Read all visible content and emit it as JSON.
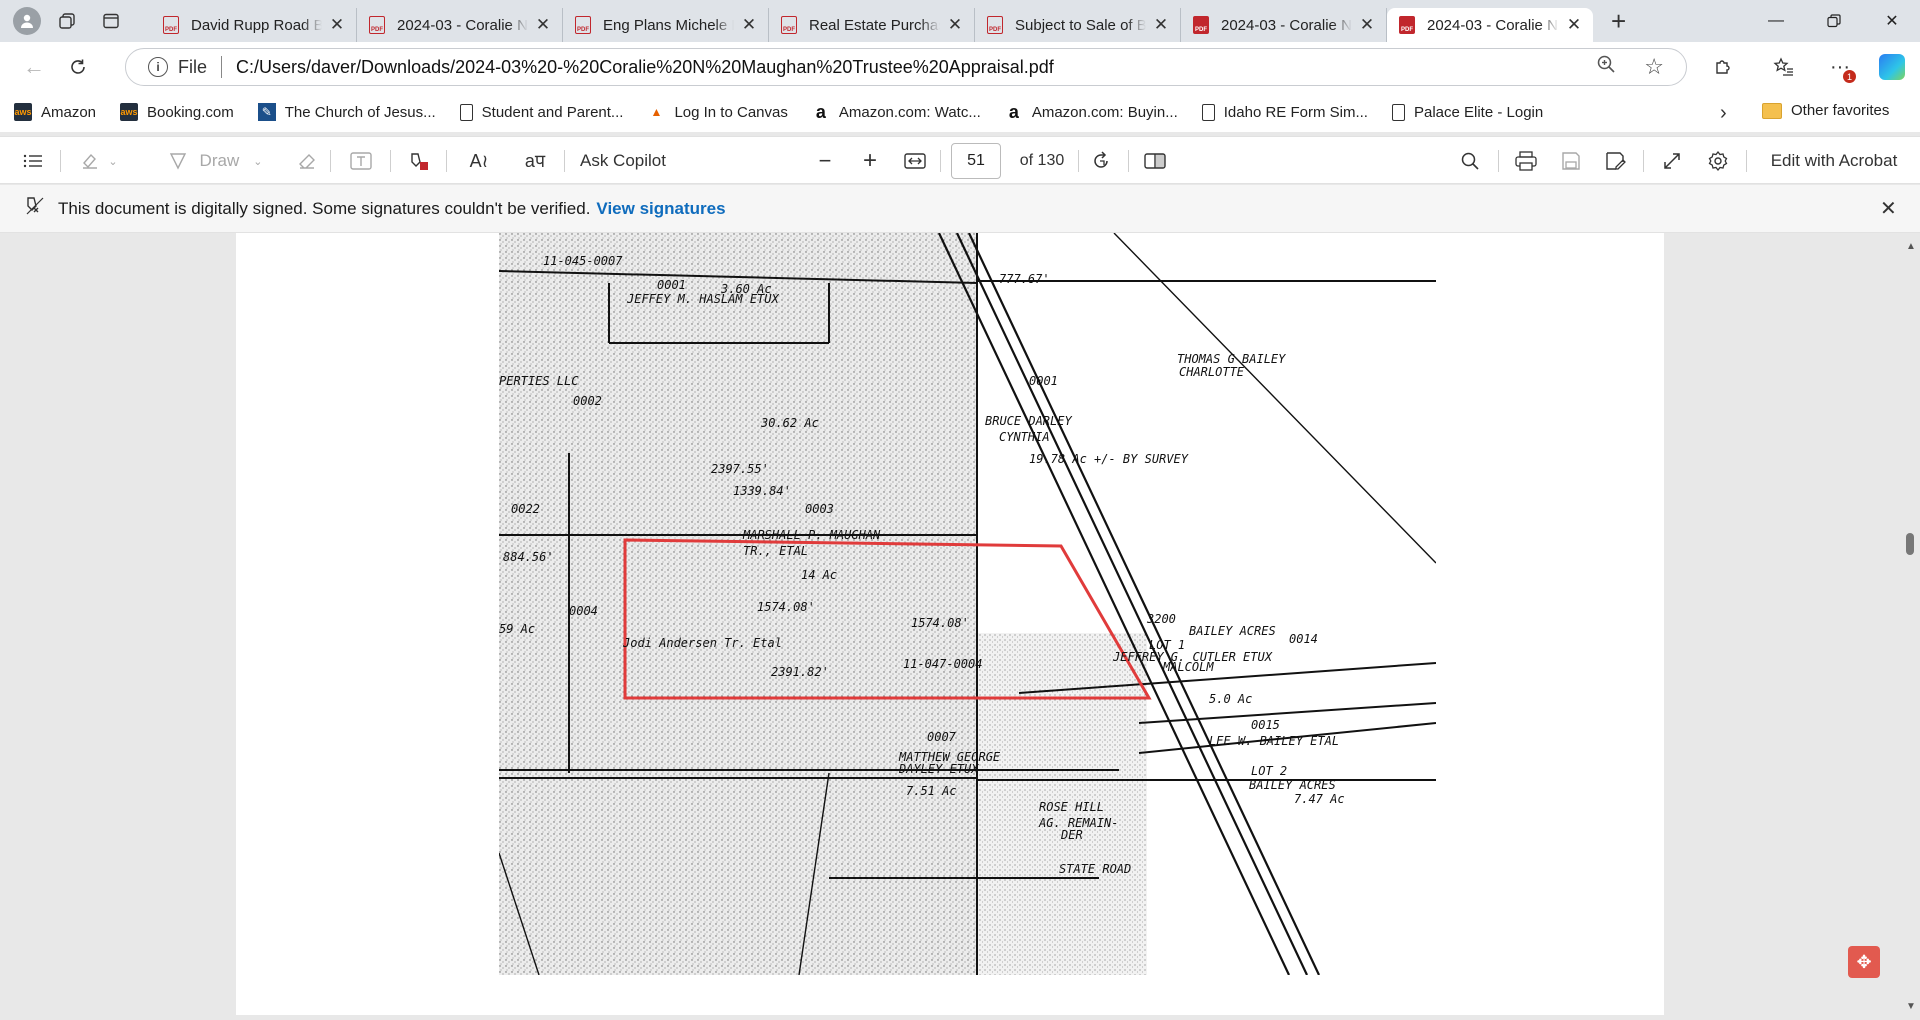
{
  "tabs": [
    {
      "title": "David Rupp Road Bu",
      "active": false
    },
    {
      "title": "2024-03 - Coralie N",
      "active": false
    },
    {
      "title": "Eng Plans Michele D",
      "active": false
    },
    {
      "title": "Real Estate Purchase",
      "active": false
    },
    {
      "title": "Subject to Sale of Bu",
      "active": false
    },
    {
      "title": "2024-03 - Coralie N",
      "active": false
    },
    {
      "title": "2024-03 - Coralie N",
      "active": true
    }
  ],
  "address": {
    "scheme_label": "File",
    "url": "C:/Users/daver/Downloads/2024-03%20-%20Coralie%20N%20Maughan%20Trustee%20Appraisal.pdf",
    "notification_count": "1"
  },
  "favorites": [
    {
      "label": "Amazon",
      "icon": "aws-icon"
    },
    {
      "label": "Booking.com",
      "icon": "aws-icon"
    },
    {
      "label": "The Church of Jesus...",
      "icon": "church-icon"
    },
    {
      "label": "Student and Parent...",
      "icon": "page-icon"
    },
    {
      "label": "Log In to Canvas",
      "icon": "canvas-icon"
    },
    {
      "label": "Amazon.com: Watc...",
      "icon": "amazon-icon"
    },
    {
      "label": "Amazon.com: Buyin...",
      "icon": "amazon-icon"
    },
    {
      "label": "Idaho RE Form Sim...",
      "icon": "page-icon"
    },
    {
      "label": "Palace Elite - Login",
      "icon": "page-icon"
    }
  ],
  "favorites_other": "Other favorites",
  "pdf_toolbar": {
    "draw_label": "Draw",
    "ask_copilot": "Ask Copilot",
    "page_number": "51",
    "page_total": "of 130",
    "edit_acrobat": "Edit with Acrobat"
  },
  "signature_bar": {
    "message": "This document is digitally signed. Some signatures couldn't be verified.",
    "link": "View signatures"
  },
  "map": {
    "labels": [
      "11-045-0007",
      "0001",
      "3.60 Ac",
      "JEFFEY M. HASLAM ETUX",
      "30.62 Ac",
      "2397.55'",
      "1339.84'",
      "0003",
      "MARSHALL P. MAUGHAN",
      "TR., ETAL",
      "14 Ac",
      "1574.08'",
      "0022",
      "0004",
      "Jodi Andersen Tr. Etal",
      "2391.82'",
      "11-047-0004",
      "0001",
      "BRUCE DARLEY",
      "CYNTHIA",
      "19.78 Ac +/- BY SURVEY",
      "THOMAS G BAILEY",
      "CHARLOTTE",
      "777.67'",
      "BAILEY ACRES",
      "0014",
      "LOT 1",
      "JEFFREY G. CUTLER ETUX",
      "MALCOLM",
      "5.0 Ac",
      "0015",
      "LEE W. BAILEY ETAL",
      "LOT 2",
      "BAILEY ACRES",
      "7.47 Ac",
      "0007",
      "MATTHEW GEORGE",
      "DAYLEY ETUX",
      "7.51 Ac",
      "ROSE HILL",
      "AG. REMAIN-",
      "DER",
      "STATE ROAD",
      "PERTIES LLC",
      "0002",
      "884.56'",
      "59 Ac",
      "3200",
      "1574.08'"
    ]
  }
}
